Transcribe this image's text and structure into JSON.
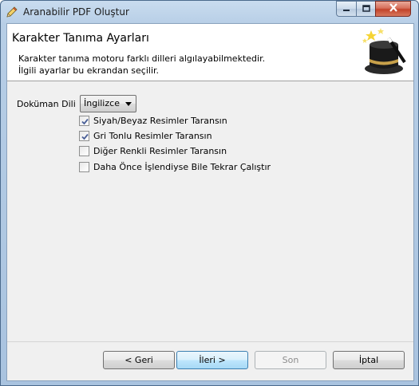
{
  "window": {
    "title": "Aranabilir PDF Oluştur"
  },
  "header": {
    "title": "Karakter Tanıma Ayarları",
    "description_line1": "Karakter tanıma motoru farklı dilleri algılayabilmektedir.",
    "description_line2": "İlgili ayarlar bu ekrandan seçilir."
  },
  "form": {
    "language_label": "Doküman Dili",
    "language_value": "İngilizce",
    "checkboxes": [
      {
        "label": "Siyah/Beyaz Resimler Taransın",
        "checked": true
      },
      {
        "label": "Gri Tonlu Resimler Taransın",
        "checked": true
      },
      {
        "label": "Diğer Renkli Resimler Taransın",
        "checked": false
      },
      {
        "label": "Daha Önce İşlendiyse Bile Tekrar Çalıştır",
        "checked": false
      }
    ]
  },
  "buttons": {
    "back": "< Geri",
    "next": "İleri >",
    "finish": "Son",
    "cancel": "İptal"
  },
  "icons": {
    "app": "pencil-icon",
    "header": "magic-hat-wand-icon"
  }
}
